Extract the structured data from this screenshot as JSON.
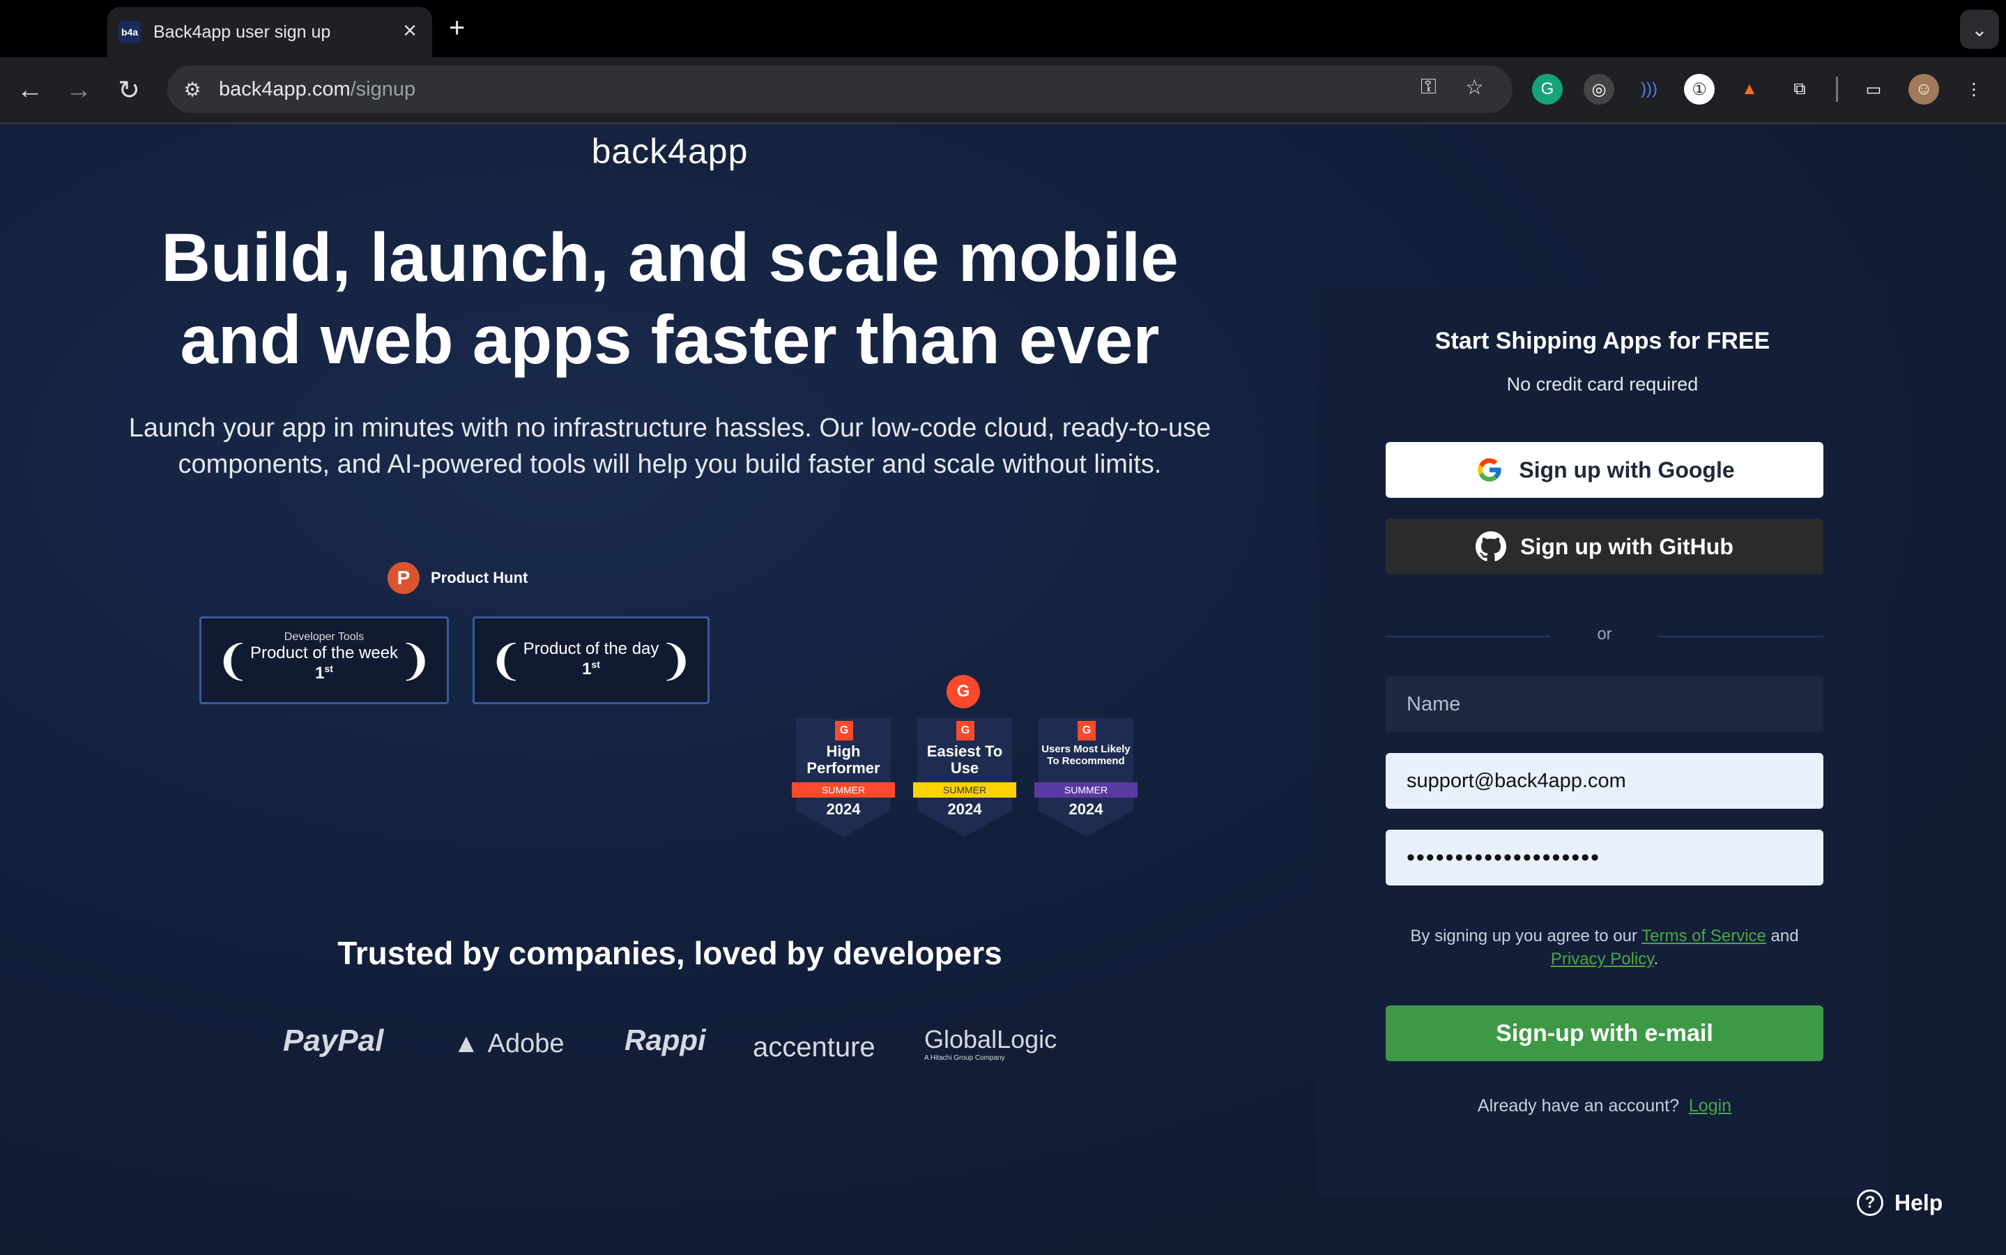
{
  "browser": {
    "tab_favicon": "b4a",
    "tab_title": "Back4app user sign up",
    "url_host": "back4app.com",
    "url_path": "/signup"
  },
  "hero": {
    "brand": "back4app",
    "headline": "Build, launch, and scale mobile and web apps faster than ever",
    "subtext": "Launch your app in minutes with no infrastructure hassles. Our low-code cloud, ready-to-use components, and AI-powered tools will help you build faster and scale without limits."
  },
  "producthunt": {
    "logo_letter": "P",
    "label": "Product Hunt",
    "badges": [
      {
        "category": "Developer Tools",
        "title": "Product of the week",
        "rank": "1",
        "rank_suffix": "st"
      },
      {
        "category": "",
        "title": "Product of the day",
        "rank": "1",
        "rank_suffix": "st"
      }
    ]
  },
  "g2": {
    "logo_letter": "G",
    "badges": [
      {
        "title": "High Performer",
        "season": "SUMMER",
        "year": "2024",
        "ribbon_color": "#ff492c"
      },
      {
        "title": "Easiest To Use",
        "season": "SUMMER",
        "year": "2024",
        "ribbon_color": "#ffd200"
      },
      {
        "title": "Users Most Likely To Recommend",
        "season": "SUMMER",
        "year": "2024",
        "ribbon_color": "#5a39a2"
      }
    ]
  },
  "trusted": {
    "heading": "Trusted by companies, loved by developers",
    "logos": [
      "PayPal",
      "Adobe",
      "Rappi",
      "accenture",
      "GlobalLogic"
    ],
    "globallogic_tagline": "A Hitachi Group Company"
  },
  "signup": {
    "title": "Start Shipping Apps for FREE",
    "subtitle": "No credit card required",
    "google_button": "Sign up with Google",
    "github_button": "Sign up with GitHub",
    "or_label": "or",
    "name_placeholder": "Name",
    "email_value": "support@back4app.com",
    "password_value": "••••••••••••••••••••",
    "terms_prefix": "By signing up you agree to our ",
    "terms_link": "Terms of Service",
    "terms_and": " and ",
    "privacy_link": "Privacy Policy",
    "terms_end": ".",
    "email_button": "Sign-up with e-mail",
    "login_prefix": "Already have an account?",
    "login_link": "Login"
  },
  "help": {
    "label": "Help"
  },
  "colors": {
    "accent_green": "#3d9946",
    "background": "#111c33"
  }
}
